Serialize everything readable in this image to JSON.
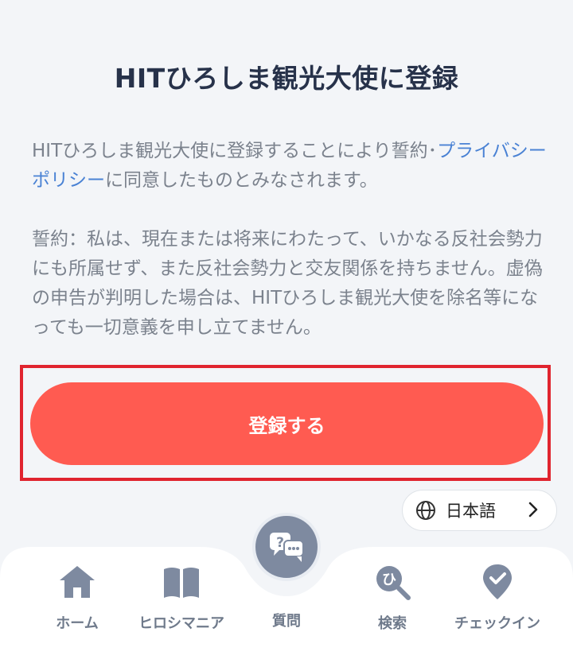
{
  "page": {
    "title": "HITひろしま観光大使に登録"
  },
  "consent": {
    "prefix": "HITひろしま観光大使に登録することにより誓約･",
    "link": "プライバシーポリシー",
    "suffix": "に同意したものとみなされます。"
  },
  "oath": {
    "text": "誓約：私は、現在または将来にわたって、いかなる反社会勢力にも所属せず、また反社会勢力と交友関係を持ちません。虚偽の申告が判明した場合は、HITひろしま観光大使を除名等になっても一切意義を申し立てません。"
  },
  "actions": {
    "register_label": "登録する"
  },
  "language": {
    "label": "日本語",
    "icon": "globe-icon"
  },
  "nav": {
    "items": [
      {
        "label": "ホーム",
        "icon": "home-icon"
      },
      {
        "label": "ヒロシマニア",
        "icon": "book-icon"
      },
      {
        "label": "質問",
        "icon": "question-chat-icon"
      },
      {
        "label": "検索",
        "icon": "search-icon"
      },
      {
        "label": "チェックイン",
        "icon": "checkin-pin-icon"
      }
    ]
  },
  "colors": {
    "accent": "#ff5b51",
    "link": "#4a82d4",
    "nav_icon": "#7e8aa0",
    "highlight_border": "#e0242f"
  }
}
